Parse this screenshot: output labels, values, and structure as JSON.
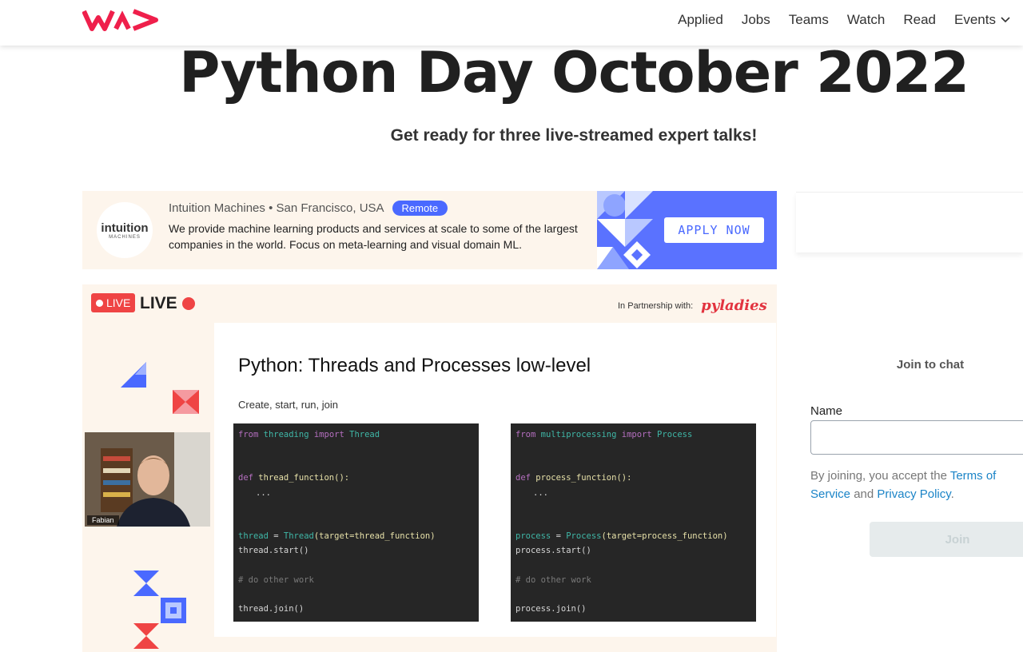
{
  "nav": {
    "items": [
      "Applied",
      "Jobs",
      "Teams",
      "Watch",
      "Read"
    ],
    "events_label": "Events"
  },
  "page": {
    "title": "Python Day October 2022",
    "subtitle": "Get ready for three live-streamed expert talks!"
  },
  "ad": {
    "logo_text": "intuition",
    "logo_subtext": "MACHINES",
    "company_location": "Intuition Machines • San Francisco, USA",
    "badge": "Remote",
    "description": "We provide machine learning products and services at scale to some of the largest companies in the world. Focus on meta-learning and visual domain ML.",
    "cta": "APPLY NOW",
    "accent_color": "#5a72ff"
  },
  "stream": {
    "live_badge": "LIVE",
    "live_big": "LIVE",
    "partnership_label": "In Partnership with:",
    "partner_name": "pyladies",
    "slide_title": "Python: Threads and Processes low-level",
    "slide_subtitle": "Create, start, run, join",
    "speaker_name": "Fabian"
  },
  "code_left": {
    "l1_kw1": "from",
    "l1_mod": "threading",
    "l1_kw2": "import",
    "l1_cls": "Thread",
    "l2_kw": "def",
    "l2_fn": "thread_function():",
    "l3": "...",
    "l4_var": "thread",
    "l4_eq": " = ",
    "l4_cls": "Thread",
    "l4_args": "(target=thread_function)",
    "l5": "thread.start()",
    "l6": "# do other work",
    "l7": "thread.join()"
  },
  "code_right": {
    "l1_kw1": "from",
    "l1_mod": "multiprocessing",
    "l1_kw2": "import",
    "l1_cls": "Process",
    "l2_kw": "def",
    "l2_fn": "process_function():",
    "l3": "...",
    "l4_var": "process",
    "l4_eq": " = ",
    "l4_cls": "Process",
    "l4_args": "(target=process_function)",
    "l5": "process.start()",
    "l6": "# do other work",
    "l7": "process.join()"
  },
  "chat": {
    "title": "Join to chat",
    "name_label": "Name",
    "name_value": "",
    "terms_prefix": "By joining, you accept the ",
    "terms_link": "Terms of Service",
    "terms_and": " and ",
    "privacy_link": "Privacy Policy",
    "terms_suffix": ".",
    "join_label": "Join"
  },
  "colors": {
    "brand": "#ef1f4b",
    "link": "#1b84c7",
    "live": "#ef4444"
  }
}
